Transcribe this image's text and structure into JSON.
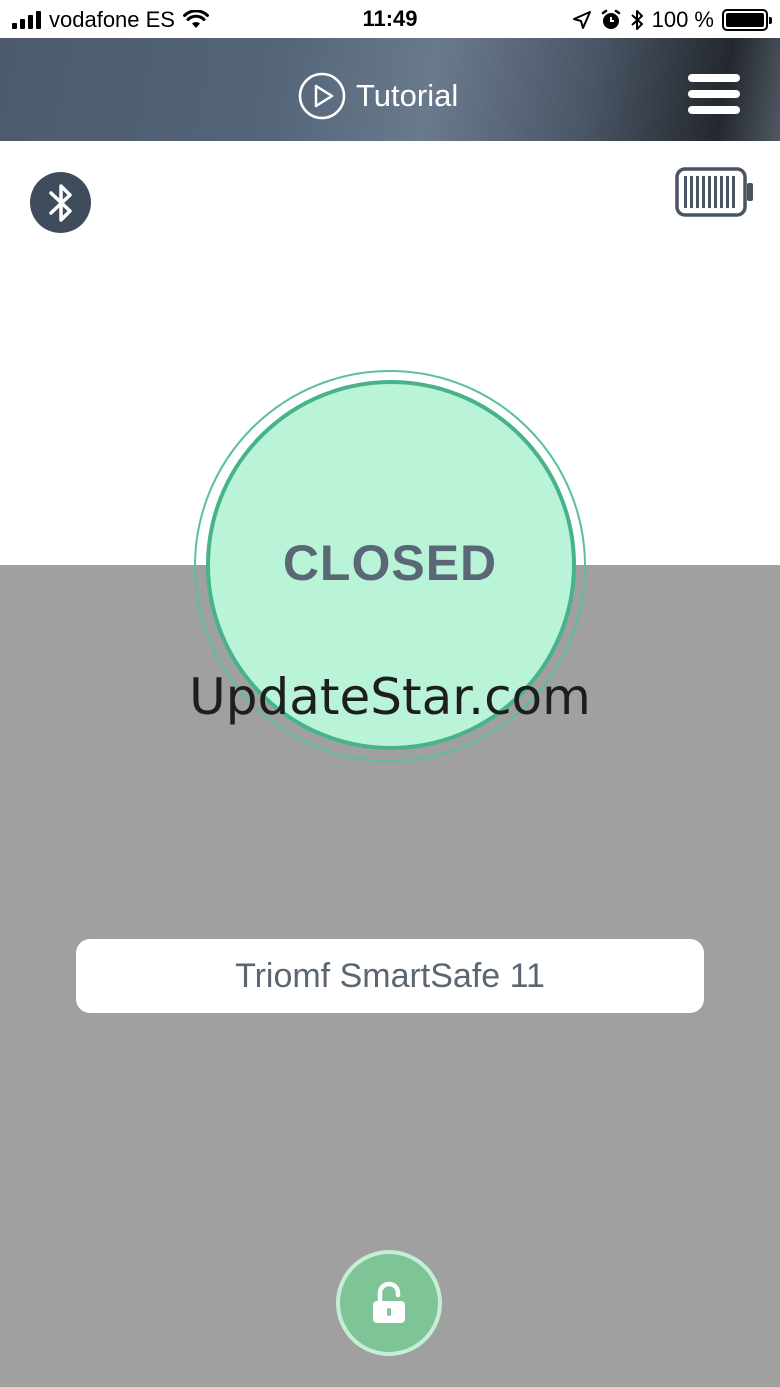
{
  "status_bar": {
    "carrier": "vodafone ES",
    "time": "11:49",
    "battery_percent": "100 %",
    "icons": [
      "signal-icon",
      "wifi-icon",
      "location-icon",
      "alarm-icon",
      "bluetooth-icon",
      "battery-icon"
    ]
  },
  "header": {
    "tutorial_label": "Tutorial",
    "icons": [
      "play-icon",
      "hamburger-menu-icon"
    ]
  },
  "connection": {
    "icon": "bluetooth-icon",
    "device_battery_icon": "device-battery-icon"
  },
  "lock_status": {
    "label": "CLOSED"
  },
  "watermark": "UpdateStar.com",
  "device": {
    "name": "Triomf SmartSafe 11"
  },
  "unlock": {
    "icon": "unlock-icon"
  },
  "colors": {
    "header_dark": "#4b5a6c",
    "status_fill": "#baf4d8",
    "status_border": "#47b38a",
    "status_text": "#5a6774",
    "grey_bg": "#a0a0a0",
    "unlock_button": "#7ec497",
    "bluetooth_badge": "#3f4c5c"
  }
}
